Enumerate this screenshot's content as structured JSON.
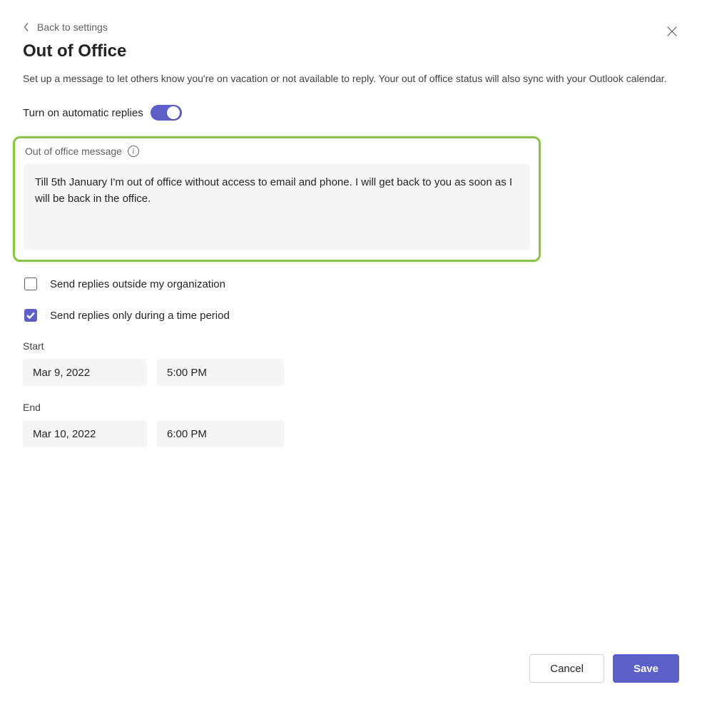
{
  "header": {
    "back_label": "Back to settings",
    "title": "Out of Office",
    "description": "Set up a message to let others know you're on vacation or not available to reply. Your out of office status will also sync with your Outlook calendar."
  },
  "toggle": {
    "label": "Turn on automatic replies",
    "enabled": true
  },
  "message": {
    "section_label": "Out of office message",
    "text": "Till 5th January I'm out of office without access to email and phone. I will get back to you as soon as I will be back in the office."
  },
  "options": {
    "send_outside": {
      "label": "Send replies outside my organization",
      "checked": false
    },
    "time_period": {
      "label": "Send replies only during a time period",
      "checked": true
    }
  },
  "period": {
    "start_label": "Start",
    "start_date": "Mar 9, 2022",
    "start_time": "5:00 PM",
    "end_label": "End",
    "end_date": "Mar 10, 2022",
    "end_time": "6:00 PM"
  },
  "footer": {
    "cancel": "Cancel",
    "save": "Save"
  }
}
